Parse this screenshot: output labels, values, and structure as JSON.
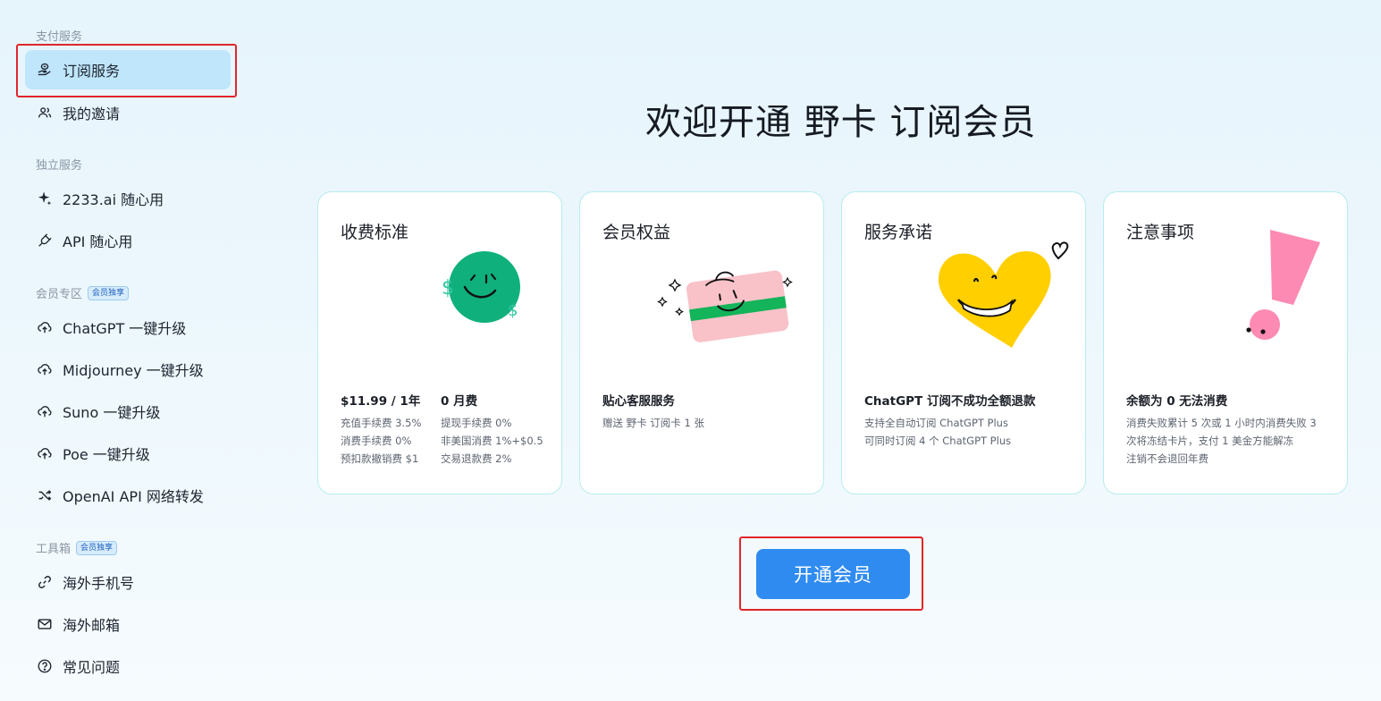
{
  "sidebar": {
    "section_payment": "支付服务",
    "subscription": "订阅服务",
    "my_invites": "我的邀请",
    "section_standalone": "独立服务",
    "ai_2233": "2233.ai 随心用",
    "api": "API 随心用",
    "section_member": "会员专区",
    "member_badge": "会员独享",
    "chatgpt": "ChatGPT 一键升级",
    "midjourney": "Midjourney 一键升级",
    "suno": "Suno 一键升级",
    "poe": "Poe 一键升级",
    "openai_forward": "OpenAI API 网络转发",
    "section_tools": "工具箱",
    "tools_badge": "会员独享",
    "phone": "海外手机号",
    "email": "海外邮箱",
    "faq": "常见问题"
  },
  "main": {
    "title": "欢迎开通 野卡 订阅会员",
    "cards": [
      {
        "title": "收费标准",
        "col1_head": "$11.99 / 1年",
        "col1_lines": [
          "充值手续费 3.5%",
          "消费手续费 0%",
          "预扣款撤销费 $1"
        ],
        "col2_head": "0 月费",
        "col2_lines": [
          "提现手续费 0%",
          "非美国消费 1%+$0.5",
          "交易退款费 2%"
        ]
      },
      {
        "title": "会员权益",
        "head": "贴心客服服务",
        "lines": [
          "赠送 野卡 订阅卡 1 张"
        ]
      },
      {
        "title": "服务承诺",
        "head": "ChatGPT 订阅不成功全额退款",
        "lines": [
          "支持全自动订阅 ChatGPT Plus",
          "可同时订阅 4 个 ChatGPT Plus"
        ]
      },
      {
        "title": "注意事项",
        "head": "余额为 0 无法消费",
        "lines": [
          "消费失败累计 5 次或 1 小时内消费失败 3",
          "次将冻结卡片，支付 1 美金方能解冻",
          "注销不会退回年费"
        ]
      }
    ],
    "open_button": "开通会员"
  },
  "colors": {
    "accent": "#2f8bef",
    "active_nav": "#bfe6fb",
    "highlight_red": "#e0262a",
    "card_border": "#b9ecee"
  },
  "icons": [
    "hand-coin-icon",
    "users-icon",
    "sparkle-icon",
    "plug-icon",
    "upload-cloud-icon",
    "shuffle-icon",
    "link-icon",
    "mail-icon",
    "question-icon"
  ]
}
